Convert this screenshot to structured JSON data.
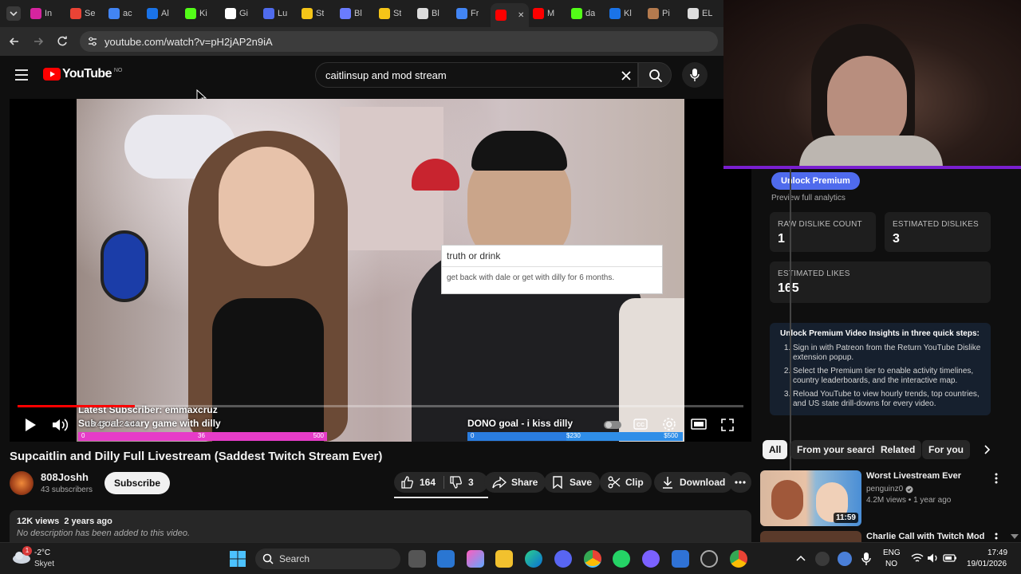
{
  "browser": {
    "tabs": [
      {
        "label": "In",
        "color": "#d6249f"
      },
      {
        "label": "Se",
        "color": "#ea4335"
      },
      {
        "label": "ac",
        "color": "#4285f4"
      },
      {
        "label": "Al",
        "color": "#1a73e8"
      },
      {
        "label": "Ki",
        "color": "#53fc18"
      },
      {
        "label": "Gi",
        "color": "#ffffff"
      },
      {
        "label": "Lu",
        "color": "#4f6bed"
      },
      {
        "label": "St",
        "color": "#f5c518"
      },
      {
        "label": "Bl",
        "color": "#6a7cff"
      },
      {
        "label": "St",
        "color": "#f5c518"
      },
      {
        "label": "Bl",
        "color": "#dddddd"
      },
      {
        "label": "Fr",
        "color": "#4285f4"
      },
      {
        "label": "",
        "color": "#ff0000"
      },
      {
        "label": "M",
        "color": "#ff0000"
      },
      {
        "label": "da",
        "color": "#53fc18"
      },
      {
        "label": "Kl",
        "color": "#1a73e8"
      },
      {
        "label": "Pi",
        "color": "#b47a4e"
      },
      {
        "label": "EL",
        "color": "#dddddd"
      }
    ],
    "url": "youtube.com/watch?v=pH2jAP2n9iA"
  },
  "youtube": {
    "logo_text": "YouTube",
    "region": "NO",
    "search_value": "caitlinsup and mod stream"
  },
  "video": {
    "overlay_box_title": "truth or drink",
    "overlay_box_text": "get back with dale or get with dilly for 6 months.",
    "latest_sub": "Latest Subscriber: emmaxcruz",
    "sub_goal": "Sub goal: scary game with dilly",
    "sub_goal_start": "0",
    "sub_goal_mid": "36",
    "sub_goal_end": "500",
    "dono_goal": "DONO goal - i kiss dilly",
    "dono_start": "0",
    "dono_mid": "$230",
    "dono_end": "$500",
    "time": "13:43 / 1:24:44",
    "progress": 0.162,
    "title": "Supcaitlin and Dilly Full Livestream (Saddest Twitch Stream Ever)"
  },
  "channel": {
    "name": "808Joshh",
    "subscribers": "43 subscribers",
    "subscribe_label": "Subscribe"
  },
  "actions": {
    "likes": "164",
    "dislikes": "3",
    "share": "Share",
    "save": "Save",
    "clip": "Clip",
    "download": "Download"
  },
  "description": {
    "meta": "12K views  2 years ago",
    "text": "No description has been added to this video."
  },
  "premium_panel": {
    "unlock_button": "Unlock Premium",
    "preview_text": "Preview full analytics",
    "raw_dislike_label": "RAW DISLIKE COUNT",
    "raw_dislike_value": "1",
    "est_dislikes_label": "ESTIMATED DISLIKES",
    "est_dislikes_value": "3",
    "est_likes_label": "ESTIMATED LIKES",
    "est_likes_value": "165",
    "insights_title": "Unlock Premium Video Insights in three quick steps:",
    "steps": [
      "Sign in with Patreon from the Return YouTube Dislike extension popup.",
      "Select the Premium tier to enable activity timelines, country leaderboards, and the interactive map.",
      "Reload YouTube to view hourly trends, top countries, and US state drill-downs for every video."
    ]
  },
  "chips": [
    "All",
    "From your search",
    "Related",
    "For you"
  ],
  "recommendations": [
    {
      "title": "Worst Livestream Ever",
      "channel": "penguinz0",
      "meta": "4.2M views • 1 year ago",
      "duration": "11:59"
    },
    {
      "title": "Charlie Call with Twitch Mod",
      "channel": "",
      "meta": "",
      "duration": ""
    }
  ],
  "taskbar": {
    "weather_temp": "-2°C",
    "weather_desc": "Skyet",
    "weather_badge": "1",
    "search_label": "Search",
    "lang_top": "ENG",
    "lang_bottom": "NO",
    "clock_time": "17:49",
    "clock_date": "19/01/2026"
  }
}
